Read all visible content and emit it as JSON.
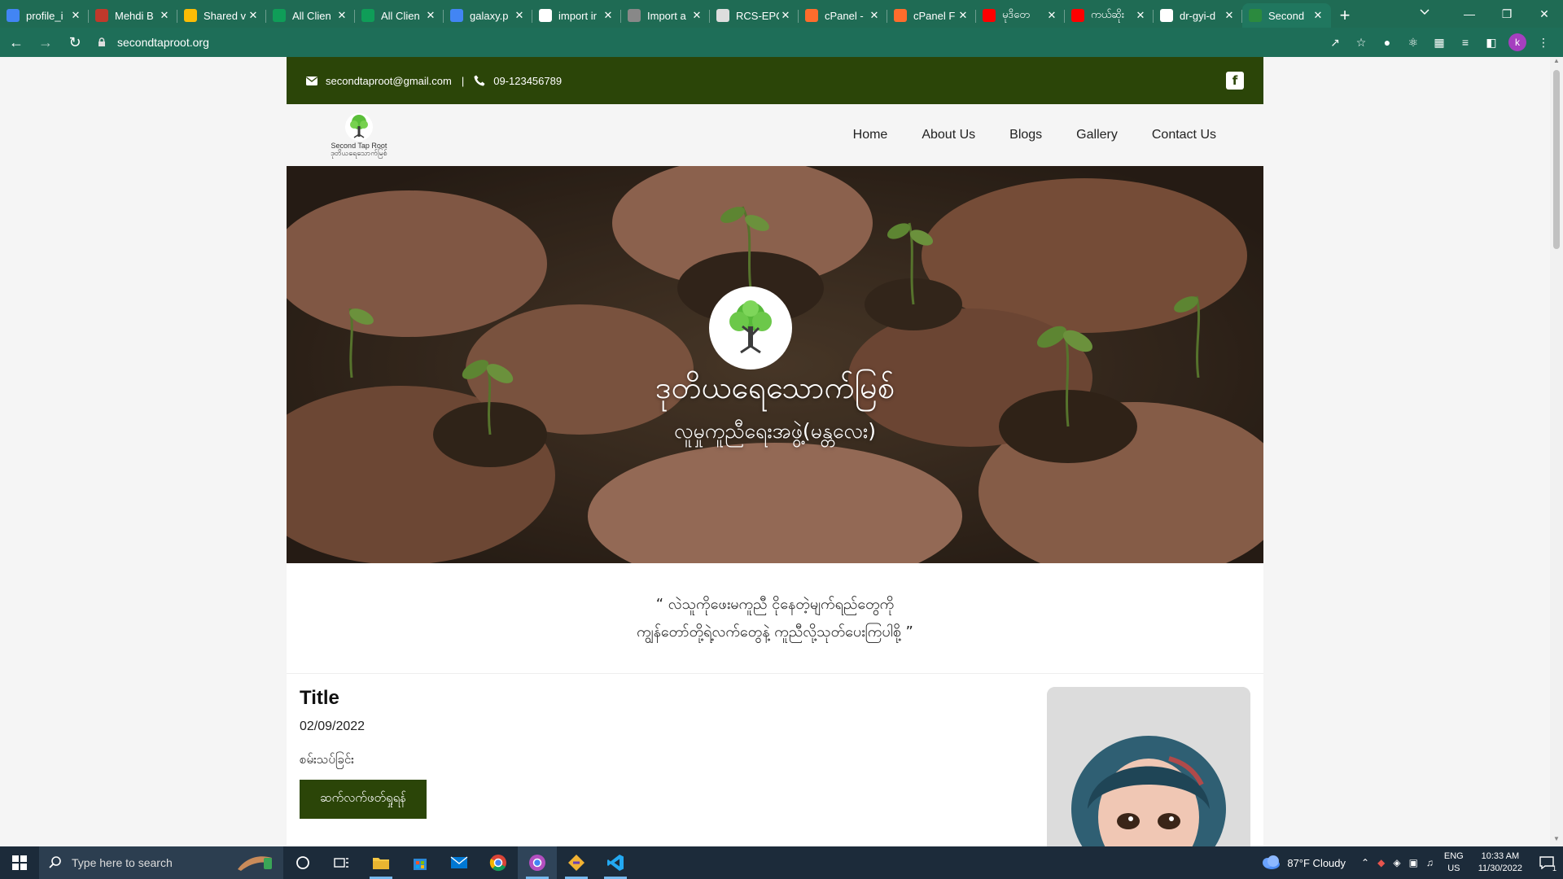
{
  "browser": {
    "tabs": [
      {
        "label": "profile_i",
        "icon": "google-drive-icon",
        "color": "#4285f4"
      },
      {
        "label": "Mehdi B",
        "icon": "m-logo-icon",
        "color": "#c0392b"
      },
      {
        "label": "Shared v",
        "icon": "google-drive-icon",
        "color": "#fbbc05"
      },
      {
        "label": "All Clien",
        "icon": "google-sheets-icon",
        "color": "#0f9d58"
      },
      {
        "label": "All Clien",
        "icon": "google-sheets-icon",
        "color": "#0f9d58"
      },
      {
        "label": "galaxy.p",
        "icon": "google-drive-icon",
        "color": "#4285f4"
      },
      {
        "label": "import ir",
        "icon": "google-icon",
        "color": "#ffffff"
      },
      {
        "label": "Import a",
        "icon": "cube-icon",
        "color": "#888888"
      },
      {
        "label": "RCS-EPC",
        "icon": "calendar-icon",
        "color": "#dddddd"
      },
      {
        "label": "cPanel -",
        "icon": "cpanel-icon",
        "color": "#ff6c2c"
      },
      {
        "label": "cPanel F",
        "icon": "cpanel-icon",
        "color": "#ff6c2c"
      },
      {
        "label": "မုဒိတေ",
        "icon": "youtube-icon",
        "color": "#ff0000"
      },
      {
        "label": "ကယ်ဆိုး",
        "icon": "youtube-icon",
        "color": "#ff0000"
      },
      {
        "label": "dr-gyi-d",
        "icon": "google-icon",
        "color": "#ffffff"
      },
      {
        "label": "Second",
        "icon": "site-favicon-icon",
        "color": "#2b8a3e",
        "active": true
      }
    ],
    "url": "secondtaproot.org"
  },
  "site": {
    "topbar": {
      "email": "secondtaproot@gmail.com",
      "divider": "|",
      "phone": "09-123456789"
    },
    "logo": {
      "line1": "Second Tap Root",
      "line2": "ဒုတိယရေသောက်မြစ်"
    },
    "nav": [
      "Home",
      "About Us",
      "Blogs",
      "Gallery",
      "Contact Us"
    ],
    "hero": {
      "title": "ဒုတိယရေသောက်မြစ်",
      "subtitle": "လူမှုကူညီရေးအဖွဲ့(မန္တလေး)"
    },
    "quote": {
      "line1": "“ လဲသူကိုဖေးမကူညီ ငိုနေတဲ့မျက်ရည်တွေကို",
      "line2": "ကျွန်တော်တို့ရဲ့လက်တွေနဲ့ ကူညီလို့သုတ်ပေးကြပါစို့ ”"
    },
    "post": {
      "title": "Title",
      "date": "02/09/2022",
      "excerpt": "စမ်းသပ်ခြင်း",
      "button": "ဆက်လက်ဖတ်ရှုရန်"
    }
  },
  "taskbar": {
    "search_placeholder": "Type here to search",
    "weather": "87°F  Cloudy",
    "lang_top": "ENG",
    "lang_bottom": "US",
    "time": "10:33 AM",
    "date": "11/30/2022",
    "notifications": "1"
  },
  "colors": {
    "chrome_green": "#1e6e58",
    "site_dark_green": "#2b4508"
  }
}
